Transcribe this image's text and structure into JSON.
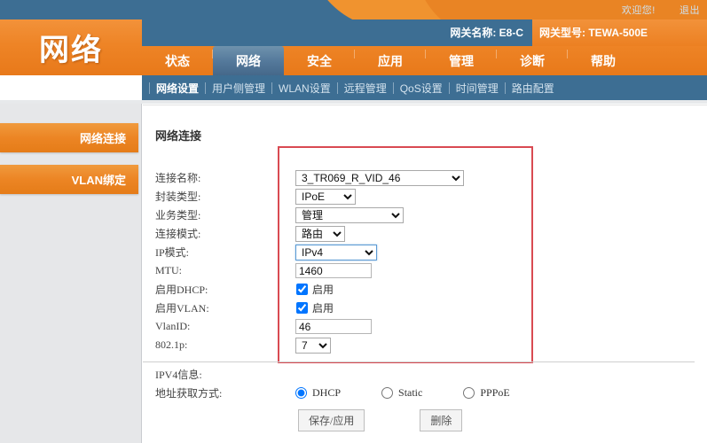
{
  "topbar": {
    "welcome": "欢迎您!",
    "logout": "退出"
  },
  "header": {
    "logo": "网络",
    "gateway_name": "网关名称:  E8-C",
    "gateway_model": "网关型号:  TEWA-500E"
  },
  "tabs": [
    {
      "label": "状态",
      "active": false
    },
    {
      "label": "网络",
      "active": true
    },
    {
      "label": "安全",
      "active": false
    },
    {
      "label": "应用",
      "active": false
    },
    {
      "label": "管理",
      "active": false
    },
    {
      "label": "诊断",
      "active": false
    },
    {
      "label": "帮助",
      "active": false
    }
  ],
  "subnav": [
    {
      "label": "网络设置",
      "active": true
    },
    {
      "label": "用户侧管理",
      "active": false
    },
    {
      "label": "WLAN设置",
      "active": false
    },
    {
      "label": "远程管理",
      "active": false
    },
    {
      "label": "QoS设置",
      "active": false
    },
    {
      "label": "时间管理",
      "active": false
    },
    {
      "label": "路由配置",
      "active": false
    }
  ],
  "sidebar": {
    "items": [
      {
        "label": "网络连接"
      },
      {
        "label": "VLAN绑定"
      }
    ]
  },
  "content": {
    "title": "网络连接",
    "fields": {
      "conn_name_label": "连接名称:",
      "conn_name_value": "3_TR069_R_VID_46",
      "encap_label": "封装类型:",
      "encap_value": "IPoE",
      "service_label": "业务类型:",
      "service_value": "管理",
      "mode_label": "连接模式:",
      "mode_value": "路由",
      "ipmode_label": "IP模式:",
      "ipmode_value": "IPv4",
      "mtu_label": "MTU:",
      "mtu_value": "1460",
      "dhcp_label": "启用DHCP:",
      "dhcp_checkbox_label": "启用",
      "vlan_label": "启用VLAN:",
      "vlan_checkbox_label": "启用",
      "vlanid_label": "VlanID:",
      "vlanid_value": "46",
      "dot1p_label": "802.1p:",
      "dot1p_value": "7"
    },
    "ipv4": {
      "section_title": "IPV4信息:",
      "mode_label": "地址获取方式:",
      "options": [
        {
          "label": "DHCP",
          "selected": true
        },
        {
          "label": "Static",
          "selected": false
        },
        {
          "label": "PPPoE",
          "selected": false
        }
      ]
    },
    "buttons": {
      "save": "保存/应用",
      "delete": "删除"
    }
  },
  "colors": {
    "orange": "#ec8524",
    "blue": "#3d6e93",
    "highlight_red": "#d94a52",
    "sidebar_bg": "#e6e7e9"
  }
}
